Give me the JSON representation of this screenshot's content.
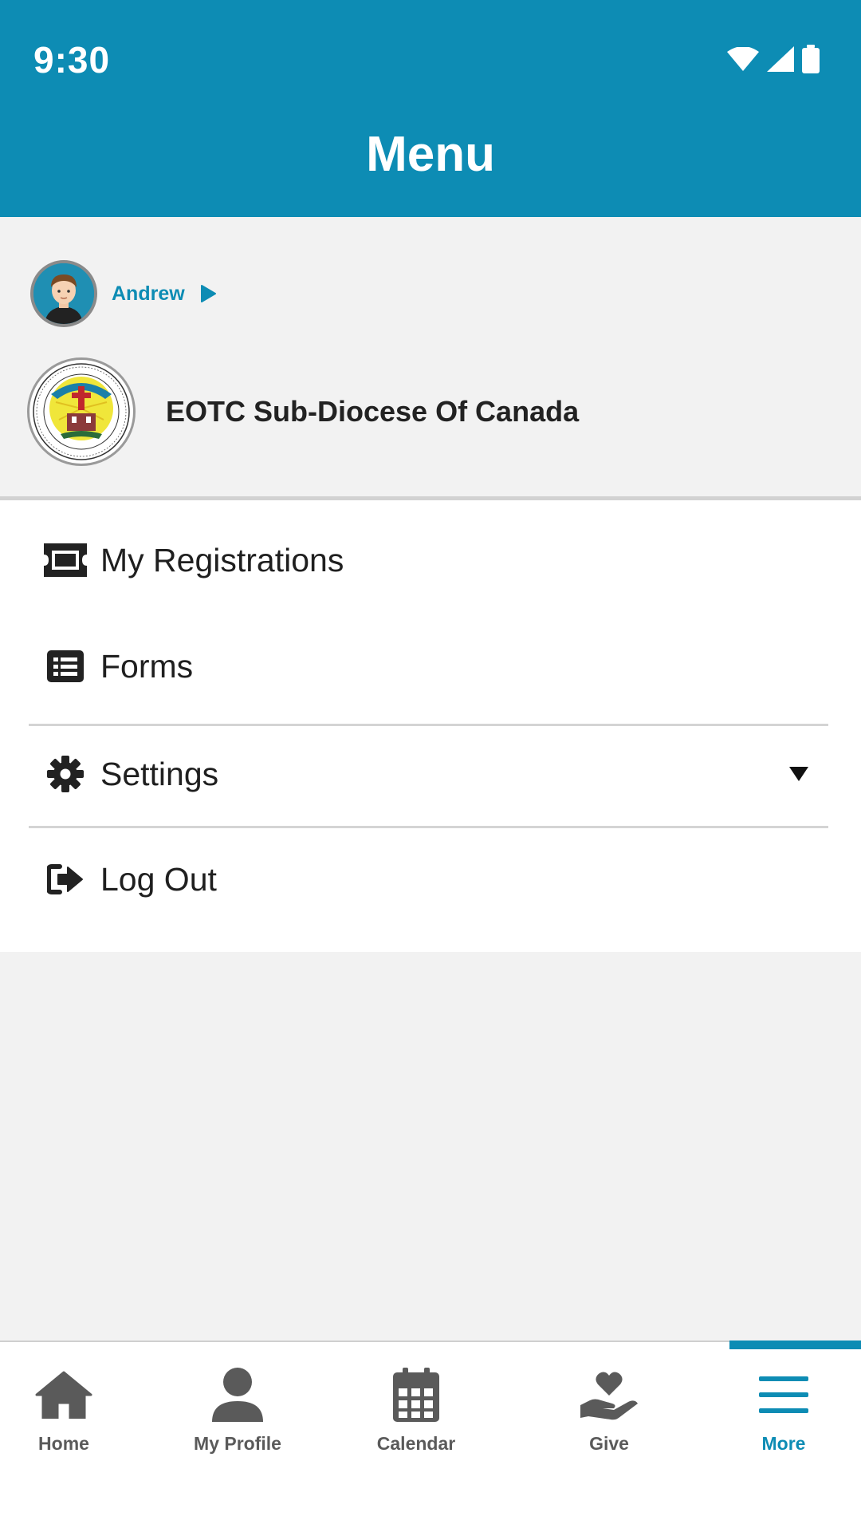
{
  "status_bar": {
    "time": "9:30"
  },
  "header": {
    "title": "Menu"
  },
  "user": {
    "name": "Andrew"
  },
  "organization": {
    "name": "EOTC Sub-Diocese Of Canada"
  },
  "menu": {
    "items": [
      {
        "label": "My Registrations",
        "icon": "ticket-icon"
      },
      {
        "label": "Forms",
        "icon": "list-icon"
      },
      {
        "label": "Settings",
        "icon": "gear-icon"
      },
      {
        "label": "Log Out",
        "icon": "logout-icon"
      }
    ]
  },
  "bottom_nav": {
    "items": [
      {
        "label": "Home",
        "icon": "home-icon"
      },
      {
        "label": "My Profile",
        "icon": "person-icon"
      },
      {
        "label": "Calendar",
        "icon": "calendar-icon"
      },
      {
        "label": "Give",
        "icon": "heart-hand-icon"
      },
      {
        "label": "More",
        "icon": "hamburger-icon"
      }
    ],
    "active": "More"
  },
  "colors": {
    "accent": "#0d8cb4",
    "background": "#f2f2f2",
    "text": "#1f1f1f",
    "nav_inactive": "#5a5a5a"
  }
}
